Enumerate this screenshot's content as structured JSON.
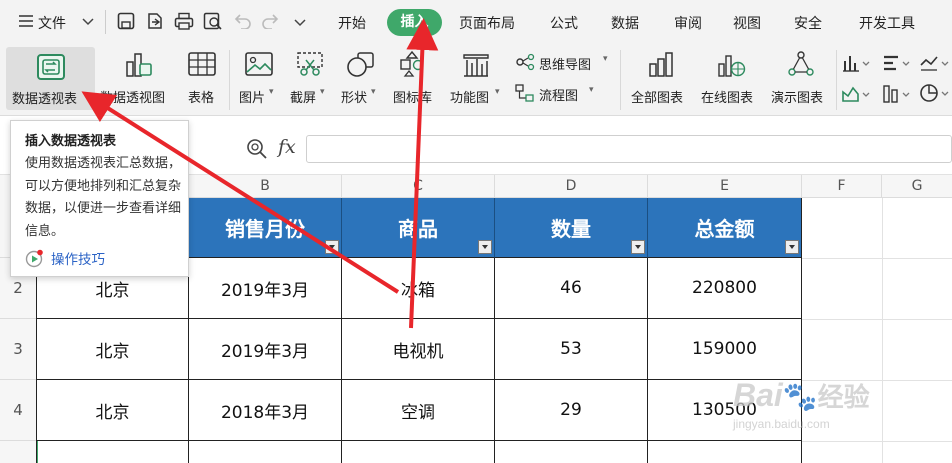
{
  "menubar": {
    "file_label": "文件",
    "tabs": [
      "开始",
      "插入",
      "页面布局",
      "公式",
      "数据",
      "审阅",
      "视图",
      "安全",
      "开发工具"
    ],
    "active_tab": "插入"
  },
  "ribbon": {
    "buttons": {
      "pivot_table": "数据透视表",
      "pivot_chart": "数据透视图",
      "table": "表格",
      "picture": "图片",
      "screenshot": "截屏",
      "shape": "形状",
      "icon_lib": "图标库",
      "func_chart": "功能图",
      "mind_map": "思维导图",
      "flowchart": "流程图",
      "all_charts": "全部图表",
      "online_chart": "在线图表",
      "demo_chart": "演示图表"
    }
  },
  "tooltip": {
    "title": "插入数据透视表",
    "body": "使用数据透视表汇总数据，可以方便地排列和汇总复杂数据，以便进一步查看详细信息。",
    "link": "操作技巧"
  },
  "formula_bar": {
    "fx_label": "fx"
  },
  "sheet": {
    "columns": [
      "B",
      "C",
      "D",
      "E",
      "F",
      "G"
    ],
    "rows": [
      "2",
      "3",
      "4"
    ],
    "headers": [
      "销售月份",
      "商品",
      "数量",
      "总金额"
    ],
    "data": [
      {
        "region": "北京",
        "month": "2019年3月",
        "product": "冰箱",
        "qty": "46",
        "amount": "220800"
      },
      {
        "region": "北京",
        "month": "2019年3月",
        "product": "电视机",
        "qty": "53",
        "amount": "159000"
      },
      {
        "region": "北京",
        "month": "2018年3月",
        "product": "空调",
        "qty": "29",
        "amount": "130500"
      }
    ]
  },
  "watermark": {
    "brand": "Bai",
    "domain": "jingyan.baidu.com",
    "text": "经验"
  },
  "colors": {
    "accent_green": "#3fa86a",
    "header_blue": "#2c74bb",
    "arrow_red": "#e8262b",
    "link_blue": "#2b63c6"
  }
}
